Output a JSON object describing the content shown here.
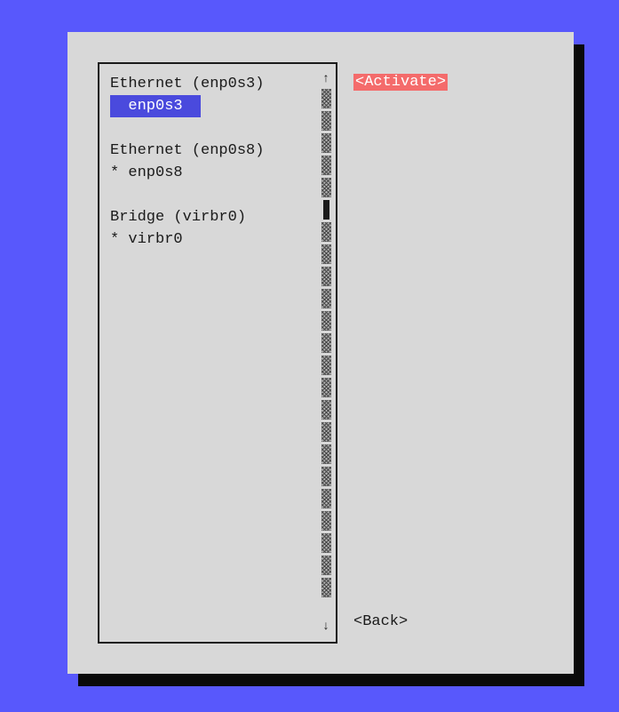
{
  "groups": [
    {
      "header": "Ethernet (enp0s3)",
      "item": "  enp0s3",
      "active": false,
      "selected": true
    },
    {
      "header": "Ethernet (enp0s8)",
      "item": "* enp0s8",
      "active": true,
      "selected": false
    },
    {
      "header": "Bridge (virbr0)",
      "item": "* virbr0",
      "active": true,
      "selected": false
    }
  ],
  "buttons": {
    "activate": "<Activate>",
    "back": "<Back>"
  },
  "scroll": {
    "up_arrow": "↑",
    "down_arrow": "↓"
  },
  "colors": {
    "background": "#5858fc",
    "dialog": "#d8d8d8",
    "selected_bg": "#4a4add",
    "activate_bg": "#f46b6b"
  }
}
